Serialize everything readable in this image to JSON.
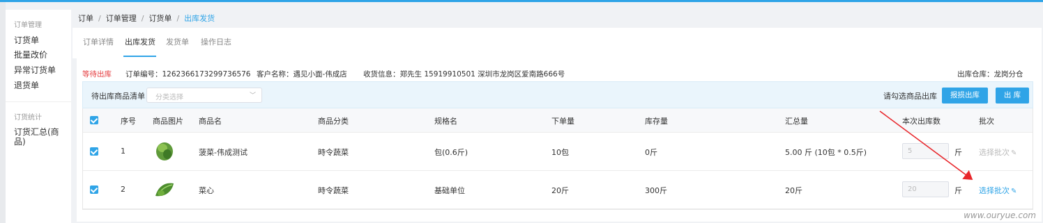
{
  "sidebar": {
    "section1": "订单管理",
    "items1": [
      "订货单",
      "批量改价",
      "异常订货单",
      "退货单"
    ],
    "section2": "订货统计",
    "items2": [
      "订货汇总(商品)"
    ]
  },
  "breadcrumb": [
    "订单",
    "订单管理",
    "订货单",
    "出库发货"
  ],
  "tabs": [
    "订单详情",
    "出库发货",
    "发货单",
    "操作日志"
  ],
  "order_info": {
    "status": "等待出库",
    "order_no": "订单编号：1262366173299736576",
    "customer": "客户名称：遇见小面-伟成店",
    "receiver": "收货信息：郑先生 15919910501 深圳市龙岗区爱南路666号",
    "warehouse": "出库仓库：龙岗分仓"
  },
  "listbar": {
    "title": "待出库商品清单",
    "category_placeholder": "分类选择",
    "hint": "请勾选商品出库",
    "btn_report": "报损出库",
    "btn_out": "出 库"
  },
  "columns": [
    "序号",
    "商品图片",
    "商品名",
    "商品分类",
    "规格名",
    "下单量",
    "库存量",
    "汇总量",
    "本次出库数",
    "批次"
  ],
  "rows": [
    {
      "no": "1",
      "name": "菠菜-伟成测试",
      "category": "時令蔬菜",
      "spec": "包(0.6斤)",
      "order_qty": "10包",
      "stock": "0斤",
      "total": "5.00 斤 (10包 * 0.5斤)",
      "out_qty": "5",
      "unit": "斤",
      "batch": "选择批次",
      "batch_enabled": false
    },
    {
      "no": "2",
      "name": "菜心",
      "category": "時令蔬菜",
      "spec": "基础单位",
      "order_qty": "20斤",
      "stock": "300斤",
      "total": "20斤",
      "out_qty": "20",
      "unit": "斤",
      "batch": "选择批次",
      "batch_enabled": true
    }
  ],
  "watermark": "www.ouryue.com",
  "colors": {
    "accent": "#2fa4e7",
    "status": "#e4393c",
    "arrow": "#e8262b"
  }
}
